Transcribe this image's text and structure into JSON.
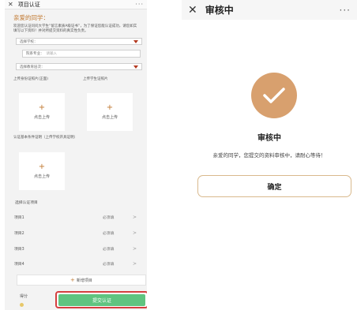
{
  "left": {
    "title": "项目认证",
    "greeting": "亲爱的同学：",
    "intro": "欢迎您认证问问大学生“留言素质A级证书”，为了保证您能认证成功，请您如实填写以下资料！并对所提交资料的真实性负责。",
    "school_select": "选择学校：",
    "major_label": "院系专业：",
    "major_placeholder": "请输入",
    "degree_select": "选择教育层次：",
    "upload_id_label": "上传身份证照片(正面)",
    "upload_student_label": "上传学生证照片",
    "upload_text": "点击上传",
    "requirement_label": "认证基本条件证明（上传学校开具证明）",
    "select_projects_label": "选择认证项目",
    "items": [
      {
        "name": "项目1",
        "required": "必须填"
      },
      {
        "name": "项目2",
        "required": "必须填"
      },
      {
        "name": "项目3",
        "required": "必须填"
      },
      {
        "name": "项目4",
        "required": "必须填"
      }
    ],
    "add_label": "新增项目",
    "score_label": "得分",
    "submit_label": "提交认证"
  },
  "right": {
    "title": "审核中",
    "status": "审核中",
    "message": "亲爱的同学，您提交的资料审核中，请耐心等待！",
    "confirm_label": "确定"
  },
  "icons": {
    "close": "close-icon",
    "more": "more-icon",
    "check": "check-icon",
    "plus": "plus-icon",
    "caret": "caret-down-icon",
    "chevron": "chevron-right-icon"
  },
  "colors": {
    "accent": "#c0772e",
    "success_bg": "#d8a06e",
    "submit_green": "#5fc480",
    "highlight_red": "#d53f3f"
  }
}
